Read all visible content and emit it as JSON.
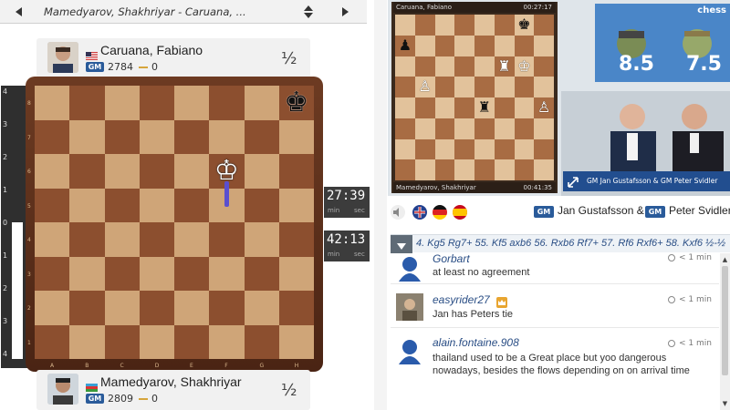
{
  "game_nav": {
    "title": "Mamedyarov, Shakhriyar - Caruana, ...",
    "prev_icon": "caret-left-icon",
    "next_icon": "caret-right-icon",
    "select_icon": "up-down-arrows-icon"
  },
  "top_player": {
    "name": "Caruana, Fabiano",
    "flag": "us-flag-icon",
    "title": "GM",
    "rating": "2784",
    "score": "0",
    "result": "½"
  },
  "bottom_player": {
    "name": "Mamedyarov, Shakhriyar",
    "flag": "az-flag-icon",
    "title": "GM",
    "rating": "2809",
    "score": "0",
    "result": "½"
  },
  "eval_bar": {
    "labels": [
      "4",
      "3",
      "2",
      "1",
      "0",
      "1",
      "2",
      "3",
      "4"
    ],
    "white_share": 0.5
  },
  "board": {
    "ranks": [
      "8",
      "7",
      "6",
      "5",
      "4",
      "3",
      "2",
      "1"
    ],
    "files": [
      "A",
      "B",
      "C",
      "D",
      "E",
      "F",
      "G",
      "H"
    ],
    "pieces": [
      {
        "type": "black-king",
        "glyph": "♚",
        "square": "h8"
      },
      {
        "type": "white-king",
        "glyph": "♔",
        "square": "f6"
      }
    ]
  },
  "clocks": {
    "top": {
      "time": "27:39",
      "min": "min",
      "sec": "sec"
    },
    "bottom": {
      "time": "42:13",
      "min": "min",
      "sec": "sec"
    }
  },
  "video": {
    "board_top_name": "Caruana, Fabiano",
    "board_top_time": "00:27:17",
    "board_bottom_name": "Mamedyarov, Shakhriyar",
    "board_bottom_time": "00:41:35",
    "score_left": "8.5",
    "score_right": "7.5",
    "brand": "chess",
    "commentators_label": "GM Jan Gustafsson & GM Peter Svidler"
  },
  "commentators": {
    "title1": "GM",
    "name1": "Jan Gustafsson &",
    "title2": "GM",
    "name2": "Peter Svidler"
  },
  "moves": {
    "text": "4. Kg5 Rg7+ 55. Kf5 axb6 56. Rxb6 Rf7+ 57. Rf6 Rxf6+ 58. Kxf6 ½-½"
  },
  "chat": [
    {
      "user": "Gorbart",
      "text": "at least no agreement",
      "time": "< 1 min",
      "avatar": "default-avatar-icon"
    },
    {
      "user": "easyrider27",
      "text": "Jan has Peters tie",
      "time": "< 1 min",
      "avatar": "photo-avatar-icon",
      "badge": "crown-badge-icon"
    },
    {
      "user": "alain.fontaine.908",
      "text": "thailand used to be a Great place but yoo dangerous nowadays, besides the flows depending on on arrival time",
      "time": "< 1 min",
      "avatar": "default-avatar-icon"
    }
  ],
  "colors": {
    "board_light": "#cfa578",
    "board_dark": "#8c4f2f",
    "link_blue": "#2a4e85",
    "gm_badge": "#2a5b9a"
  }
}
